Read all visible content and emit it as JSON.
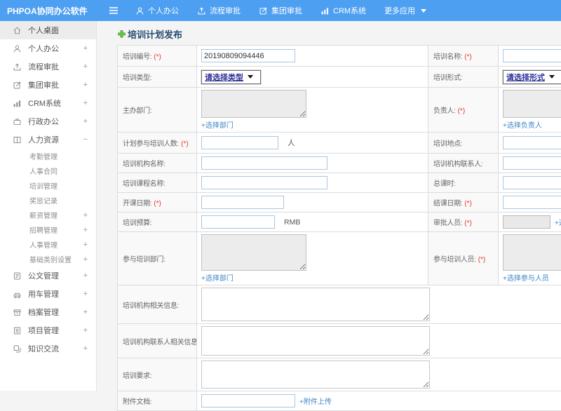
{
  "topbar": {
    "logo": "PHPOA协同办公软件",
    "nav": [
      {
        "label": "个人办公"
      },
      {
        "label": "流程审批"
      },
      {
        "label": "集团审批"
      },
      {
        "label": "CRM系统"
      },
      {
        "label": "更多应用"
      }
    ]
  },
  "sidebar": {
    "items": [
      {
        "label": "个人桌面",
        "expand": ""
      },
      {
        "label": "个人办公",
        "expand": "+"
      },
      {
        "label": "流程审批",
        "expand": "+"
      },
      {
        "label": "集团审批",
        "expand": "+"
      },
      {
        "label": "CRM系统",
        "expand": "+"
      },
      {
        "label": "行政办公",
        "expand": "+"
      },
      {
        "label": "人力资源",
        "expand": "−"
      },
      {
        "label": "公文管理",
        "expand": "+"
      },
      {
        "label": "用车管理",
        "expand": "+"
      },
      {
        "label": "档案管理",
        "expand": "+"
      },
      {
        "label": "项目管理",
        "expand": "+"
      },
      {
        "label": "知识交流",
        "expand": "+"
      }
    ],
    "hr_children": [
      {
        "label": "考勤管理",
        "expand": ""
      },
      {
        "label": "人事合同",
        "expand": ""
      },
      {
        "label": "培训管理",
        "expand": ""
      },
      {
        "label": "奖惩记录",
        "expand": ""
      },
      {
        "label": "薪资管理",
        "expand": "+"
      },
      {
        "label": "招聘管理",
        "expand": "+"
      },
      {
        "label": "人事管理",
        "expand": "+"
      },
      {
        "label": "基础类别设置",
        "expand": "+"
      }
    ]
  },
  "form": {
    "title": "培训计划发布",
    "required_mark": "(*)",
    "fields": {
      "training_no": {
        "label": "培训编号:",
        "value": "20190809094446"
      },
      "training_name": {
        "label": "培训名称:"
      },
      "training_type": {
        "label": "培训类型:",
        "selected": "请选择类型"
      },
      "training_form": {
        "label": "培训形式:",
        "selected": "请选择形式"
      },
      "host_dept": {
        "label": "主办部门:",
        "link": "+选择部门"
      },
      "leader": {
        "label": "负责人:",
        "link": "+选择负责人"
      },
      "planned_count": {
        "label": "计划参与培训人数:",
        "suffix": "人"
      },
      "location": {
        "label": "培训地点:"
      },
      "org_name": {
        "label": "培训机构名称:"
      },
      "org_contact": {
        "label": "培训机构联系人:"
      },
      "course_name": {
        "label": "培训课程名称:"
      },
      "total_hours": {
        "label": "总课时:"
      },
      "start_date": {
        "label": "开课日期:"
      },
      "end_date": {
        "label": "结课日期:"
      },
      "budget": {
        "label": "培训预算:",
        "suffix": "RMB"
      },
      "approver": {
        "label": "审批人员:",
        "link": "+选择审批人员"
      },
      "join_depts": {
        "label": "参与培训部门:",
        "link": "+选择部门"
      },
      "join_people": {
        "label": "参与培训人员:",
        "link": "+选择参与人员"
      },
      "org_info": {
        "label": "培训机构相关信息:"
      },
      "org_contact_info": {
        "label": "培训机构联系人相关信息:"
      },
      "requirements": {
        "label": "培训要求:"
      },
      "attachment": {
        "label": "附件文档:",
        "link": "+附件上传"
      }
    }
  }
}
